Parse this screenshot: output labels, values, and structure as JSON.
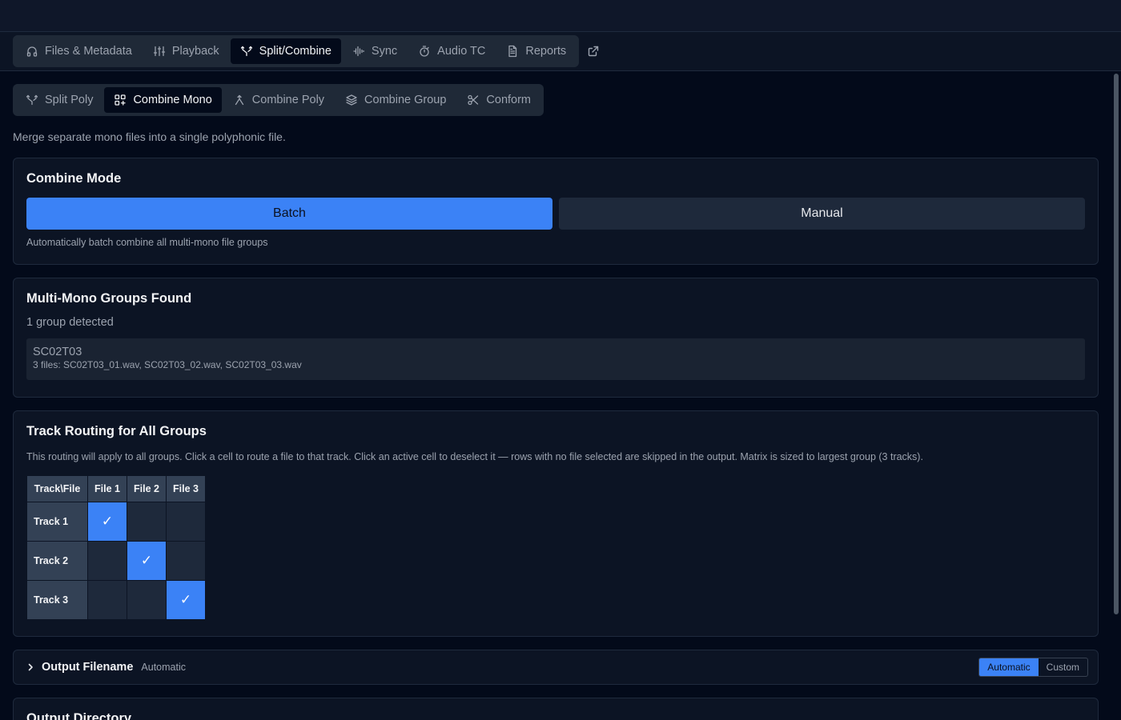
{
  "main_tabs": [
    {
      "label": "Files & Metadata",
      "icon": "headphones-icon"
    },
    {
      "label": "Playback",
      "icon": "sliders-icon"
    },
    {
      "label": "Split/Combine",
      "icon": "split-icon",
      "active": true
    },
    {
      "label": "Sync",
      "icon": "waveform-icon"
    },
    {
      "label": "Audio TC",
      "icon": "timer-icon"
    },
    {
      "label": "Reports",
      "icon": "document-icon"
    }
  ],
  "sub_tabs": [
    {
      "label": "Split Poly",
      "icon": "split-icon"
    },
    {
      "label": "Combine Mono",
      "icon": "grid-icon",
      "active": true
    },
    {
      "label": "Combine Poly",
      "icon": "merge-icon"
    },
    {
      "label": "Combine Group",
      "icon": "layers-icon"
    },
    {
      "label": "Conform",
      "icon": "scissors-icon"
    }
  ],
  "description": "Merge separate mono files into a single polyphonic file.",
  "combine_mode": {
    "title": "Combine Mode",
    "batch_label": "Batch",
    "manual_label": "Manual",
    "selected": "Batch",
    "hint": "Automatically batch combine all multi-mono file groups"
  },
  "groups": {
    "title": "Multi-Mono Groups Found",
    "count_text": "1 group detected",
    "items": [
      {
        "name": "SC02T03",
        "files": "3 files: SC02T03_01.wav, SC02T03_02.wav, SC02T03_03.wav"
      }
    ]
  },
  "routing": {
    "title": "Track Routing for All Groups",
    "description": "This routing will apply to all groups. Click a cell to route a file to that track. Click an active cell to deselect it — rows with no file selected are skipped in the output. Matrix is sized to largest group (3 tracks).",
    "corner": "Track\\File",
    "columns": [
      "File 1",
      "File 2",
      "File 3"
    ],
    "rows": [
      {
        "label": "Track 1",
        "cells": [
          true,
          false,
          false
        ]
      },
      {
        "label": "Track 2",
        "cells": [
          false,
          true,
          false
        ]
      },
      {
        "label": "Track 3",
        "cells": [
          false,
          false,
          true
        ]
      }
    ],
    "check_glyph": "✓"
  },
  "output_filename": {
    "title": "Output Filename",
    "mode_text": "Automatic",
    "options": [
      "Automatic",
      "Custom"
    ],
    "selected": "Automatic"
  },
  "output_directory": {
    "title": "Output Directory"
  },
  "colors": {
    "accent": "#3b82f6",
    "background": "#030a1a",
    "card": "#0c1424"
  }
}
